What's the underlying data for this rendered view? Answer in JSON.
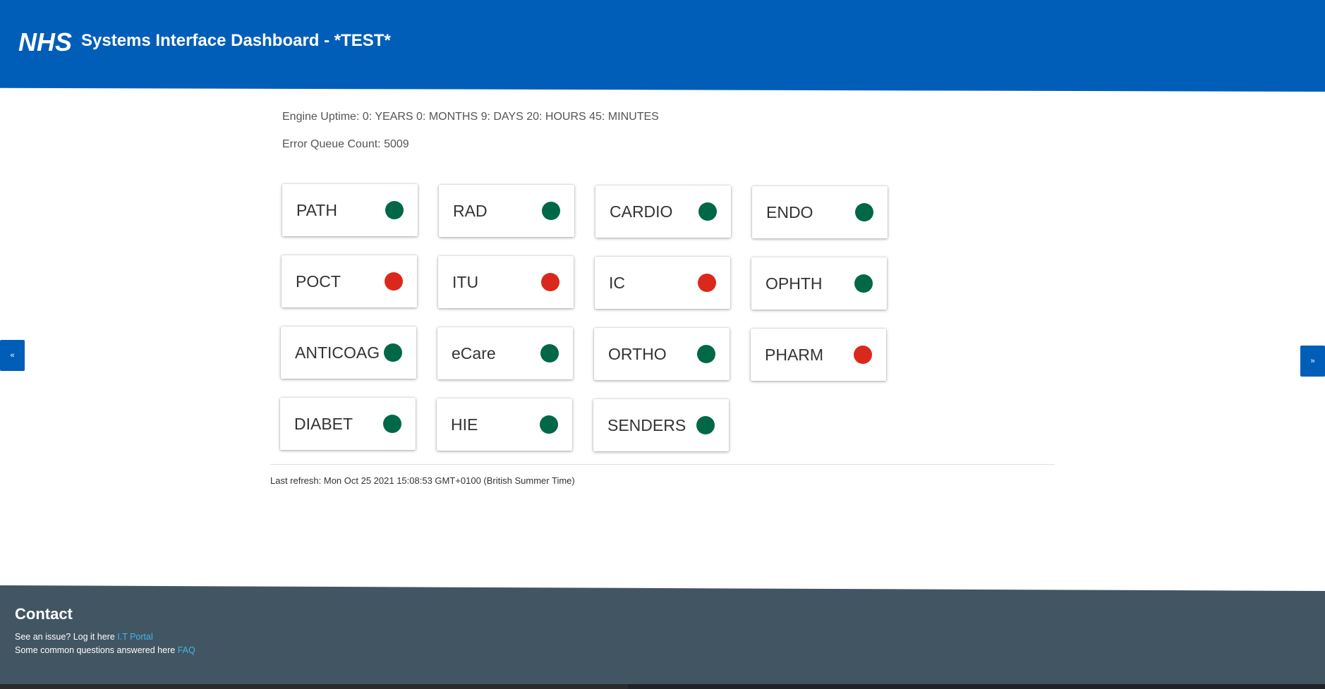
{
  "header": {
    "logo_text": "NHS",
    "title": "Systems Interface Dashboard - *TEST*",
    "bg_color": "#005eb8"
  },
  "info": {
    "uptime": "Engine Uptime: 0: YEARS 0: MONTHS 9: DAYS 20: HOURS 45: MINUTES",
    "error_queue": "Error Queue Count: 5009"
  },
  "status_colors": {
    "ok": "#006747",
    "error": "#da291c"
  },
  "tiles": [
    {
      "label": "PATH",
      "status": "ok"
    },
    {
      "label": "RAD",
      "status": "ok"
    },
    {
      "label": "CARDIO",
      "status": "ok"
    },
    {
      "label": "ENDO",
      "status": "ok"
    },
    {
      "label": "POCT",
      "status": "error"
    },
    {
      "label": "ITU",
      "status": "error"
    },
    {
      "label": "IC",
      "status": "error"
    },
    {
      "label": "OPHTH",
      "status": "ok"
    },
    {
      "label": "ANTICOAG",
      "status": "ok"
    },
    {
      "label": "eCare",
      "status": "ok"
    },
    {
      "label": "ORTHO",
      "status": "ok"
    },
    {
      "label": "PHARM",
      "status": "error"
    },
    {
      "label": "DIABET",
      "status": "ok"
    },
    {
      "label": "HIE",
      "status": "ok"
    },
    {
      "label": "SENDERS",
      "status": "ok"
    }
  ],
  "last_refresh": "Last refresh: Mon Oct 25 2021 15:08:53 GMT+0100 (British Summer Time)",
  "nav": {
    "prev_label": "«",
    "next_label": "»"
  },
  "footer": {
    "title": "Contact",
    "line1_text": "See an issue? Log it here ",
    "line1_link": "I.T Portal",
    "line2_text": "Some common questions answered here ",
    "line2_link": "FAQ"
  }
}
